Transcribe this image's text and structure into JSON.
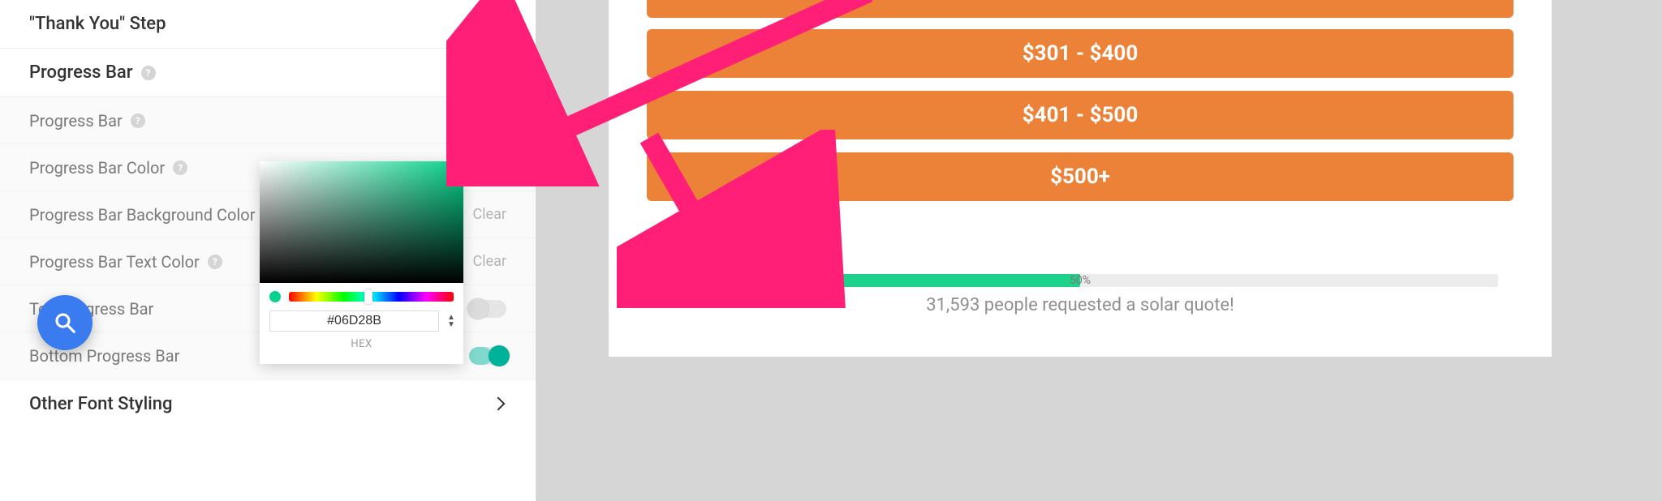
{
  "sidebar": {
    "thank_you_label": "\"Thank You\" Step",
    "progress_bar_label": "Progress Bar",
    "settings": {
      "progress_bar": "Progress Bar",
      "progress_bar_color": "Progress Bar Color",
      "progress_bar_bg_color": "Progress Bar Background Color",
      "progress_bar_text_color": "Progress Bar Text Color",
      "top_progress_bar": "Top Progress Bar",
      "bottom_progress_bar": "Bottom Progress Bar"
    },
    "clear_label": "Clear",
    "other_font_styling": "Other Font Styling"
  },
  "color_picker": {
    "hex_value": "#06D28B",
    "hex_label": "HEX",
    "swatch_color": "#06D28B"
  },
  "preview": {
    "options": {
      "opt2": "$301 - $400",
      "opt3": "$401 - $500",
      "opt4": "$500+"
    },
    "progress": {
      "percent_text": "50%",
      "percent_value": 50
    },
    "caption": "31,593 people requested a solar quote!"
  }
}
